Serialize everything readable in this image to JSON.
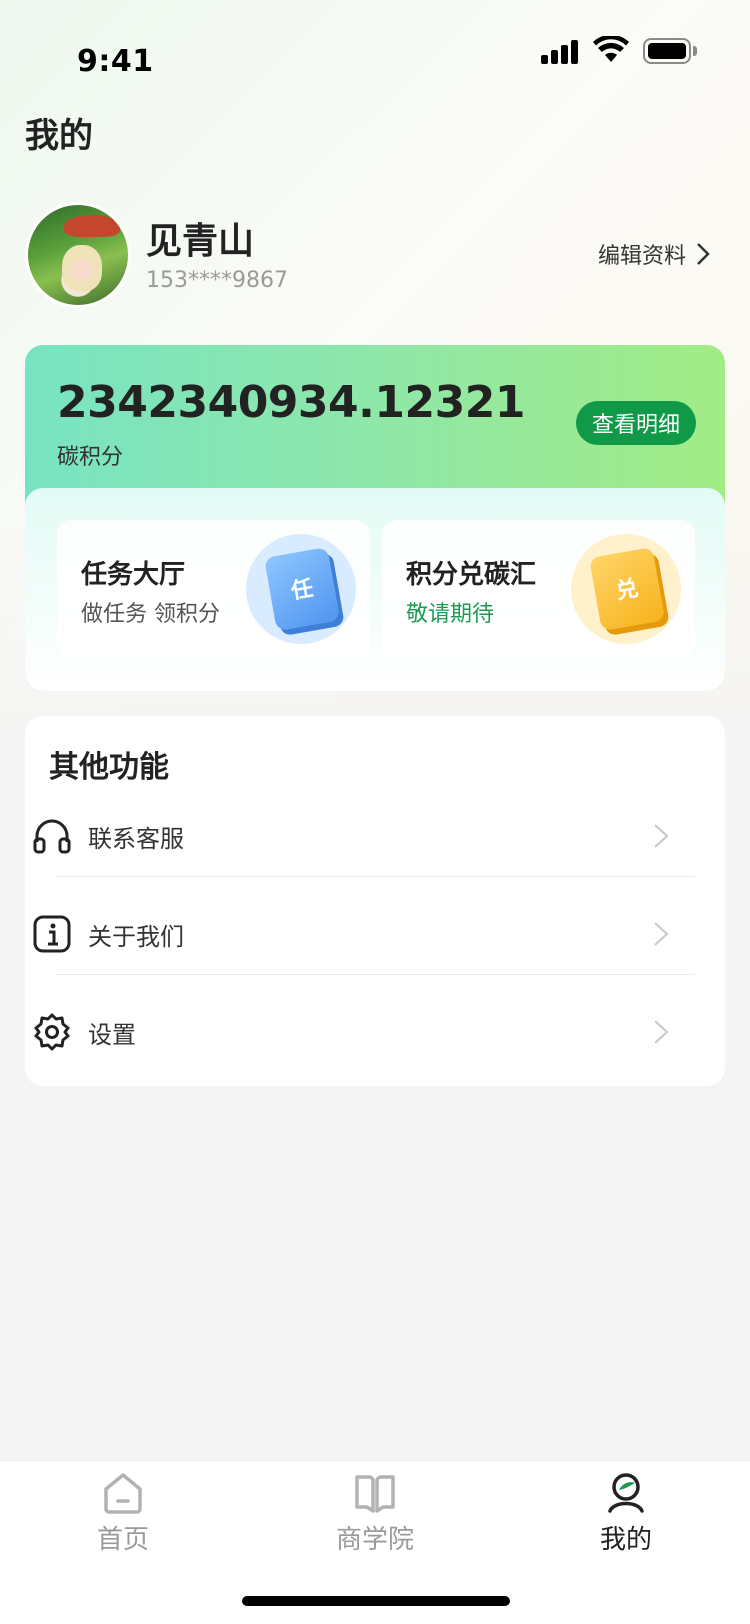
{
  "status_bar": {
    "time": "9:41"
  },
  "page": {
    "title": "我的"
  },
  "profile": {
    "name": "见青山",
    "phone": "153****9867",
    "edit_label": "编辑资料"
  },
  "points": {
    "value": "2342340934.12321",
    "label": "碳积分",
    "detail_button": "查看明细",
    "entries": [
      {
        "title": "任务大厅",
        "subtitle": "做任务 领积分",
        "icon": "task-book-icon",
        "badge": "任"
      },
      {
        "title": "积分兑碳汇",
        "subtitle": "敬请期待",
        "icon": "exchange-book-icon",
        "badge": "兑"
      }
    ]
  },
  "functions": {
    "title": "其他功能",
    "items": [
      {
        "label": "联系客服",
        "icon": "headphones-icon"
      },
      {
        "label": "关于我们",
        "icon": "info-icon"
      },
      {
        "label": "设置",
        "icon": "gear-icon"
      }
    ]
  },
  "tabbar": {
    "items": [
      {
        "label": "首页",
        "icon": "home-icon"
      },
      {
        "label": "商学院",
        "icon": "book-open-icon"
      },
      {
        "label": "我的",
        "icon": "user-icon",
        "active": true
      }
    ]
  },
  "colors": {
    "accent": "#109a48",
    "green_text": "#1e9a52"
  }
}
